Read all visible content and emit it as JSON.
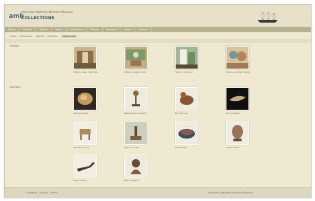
{
  "header": {
    "logo_mark": "amb",
    "logo_text": "Australian National Maritime Museum",
    "logo_sub": "COLLECTIONS",
    "top_links": [
      "·",
      "·",
      "·",
      "·",
      "·"
    ]
  },
  "nav": {
    "items": [
      "Home",
      "Explore",
      "Search",
      "About",
      "Collections",
      "Events",
      "Research",
      "Shop",
      "Contact"
    ]
  },
  "breadcrumbs": {
    "items": [
      "Home",
      "Collections",
      "Objects",
      "Artefacts"
    ],
    "current": "Object set"
  },
  "sections": {
    "first_label": "Interiors",
    "second_label": "Artefacts"
  },
  "tiles": [
    {
      "caption": "Interior view, main hall",
      "icon": "photo-icon"
    },
    {
      "caption": "Interior, gallery room",
      "icon": "photo-icon"
    },
    {
      "caption": "Interior, doorway",
      "icon": "photo-icon"
    },
    {
      "caption": "Interior, painted ceiling",
      "icon": "photo-icon"
    },
    {
      "caption": "Carved object",
      "icon": "photo-icon"
    },
    {
      "caption": "Brass figure on stand",
      "icon": "photo-icon"
    },
    {
      "caption": "Bird figurine",
      "icon": "photo-icon"
    },
    {
      "caption": "Fish sculpture",
      "icon": "photo-icon"
    },
    {
      "caption": "Animal carving",
      "icon": "photo-icon"
    },
    {
      "caption": "Figure on base",
      "icon": "photo-icon"
    },
    {
      "caption": "Shell object",
      "icon": "photo-icon"
    },
    {
      "caption": "Carved head",
      "icon": "photo-icon"
    },
    {
      "caption": "Pipe / utensil",
      "icon": "photo-icon"
    },
    {
      "caption": "Bust sculpture",
      "icon": "photo-icon"
    }
  ],
  "footer": {
    "left": "Copyright · Privacy · Terms",
    "right": "Australian National Maritime Museum"
  },
  "colors": {
    "background": "#efe9d2",
    "nav": "#b8b190",
    "accent": "#2f5363"
  }
}
